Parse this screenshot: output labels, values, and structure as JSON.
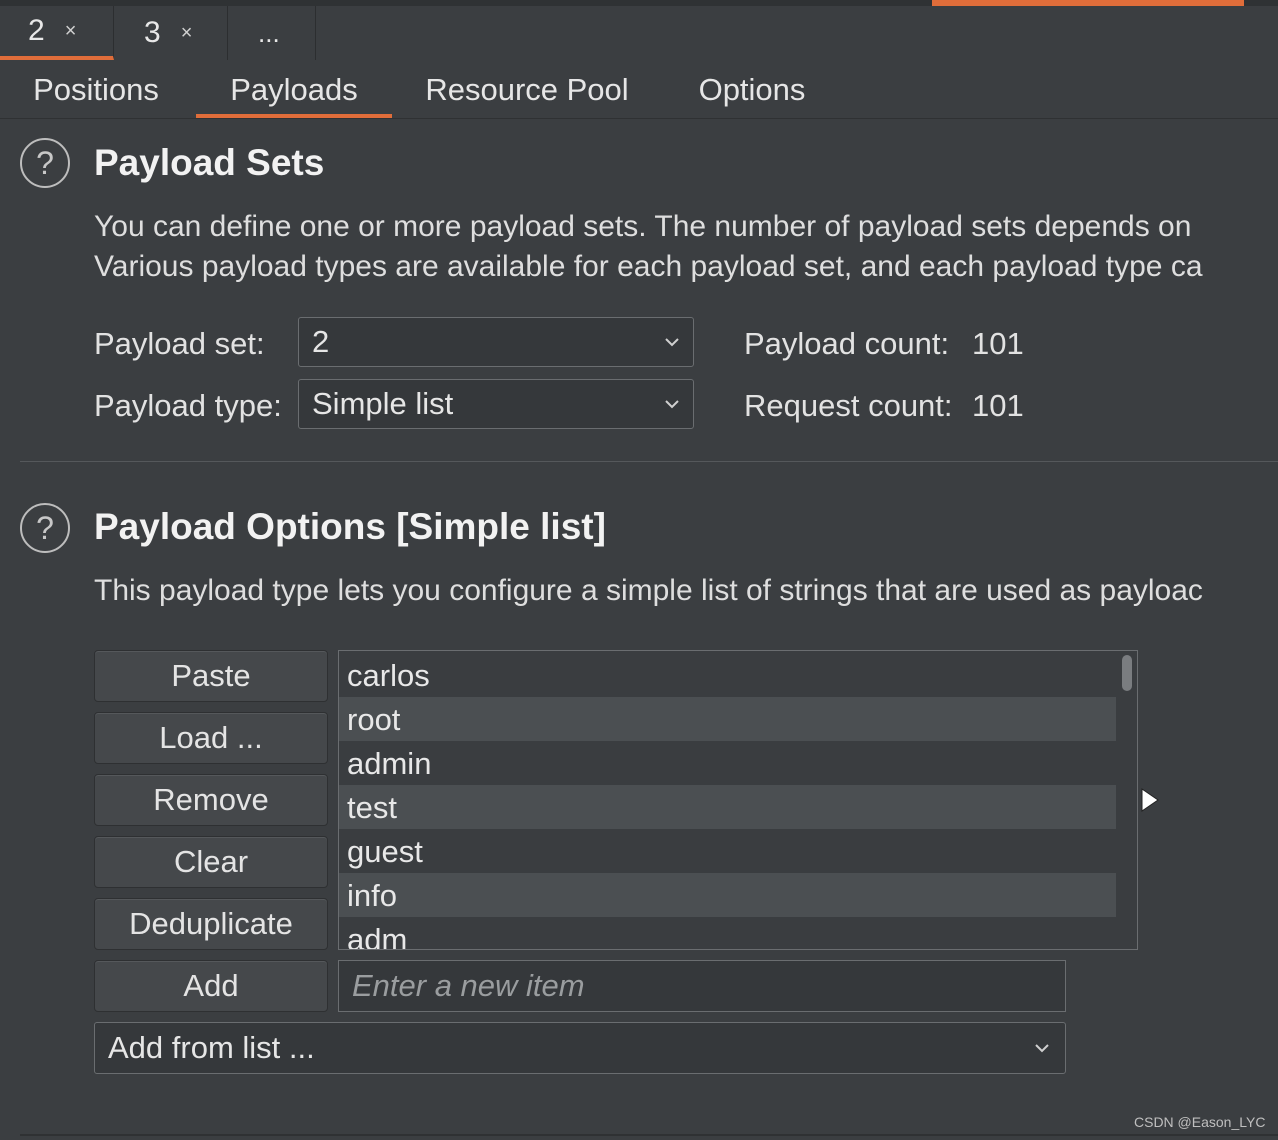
{
  "request_tabs": [
    {
      "label": "2",
      "close": "×"
    },
    {
      "label": "3",
      "close": "×"
    },
    {
      "label": "..."
    }
  ],
  "section_tabs": [
    "Positions",
    "Payloads",
    "Resource Pool",
    "Options"
  ],
  "active_section_tab": "Payloads",
  "payload_sets": {
    "help": "?",
    "title": "Payload Sets",
    "desc_line1": "You can define one or more payload sets. The number of payload sets depends on",
    "desc_line2": "Various payload types are available for each payload set, and each payload type ca",
    "set_label": "Payload set:",
    "set_value": "2",
    "type_label": "Payload type:",
    "type_value": "Simple list",
    "count_label": "Payload count:",
    "count_value": "101",
    "request_label": "Request count:",
    "request_value": "101"
  },
  "payload_options": {
    "help": "?",
    "title": "Payload Options [Simple list]",
    "desc": "This payload type lets you configure a simple list of strings that are used as payloac",
    "buttons": {
      "paste": "Paste",
      "load": "Load ...",
      "remove": "Remove",
      "clear": "Clear",
      "dedupe": "Deduplicate",
      "add": "Add"
    },
    "items": [
      "carlos",
      "root",
      "admin",
      "test",
      "guest",
      "info",
      "adm"
    ],
    "new_item_placeholder": "Enter a new item",
    "add_from_list": "Add from list ..."
  },
  "watermark": "CSDN @Eason_LYC",
  "colors": {
    "accent": "#e06d3a",
    "background": "#3b3e41"
  }
}
